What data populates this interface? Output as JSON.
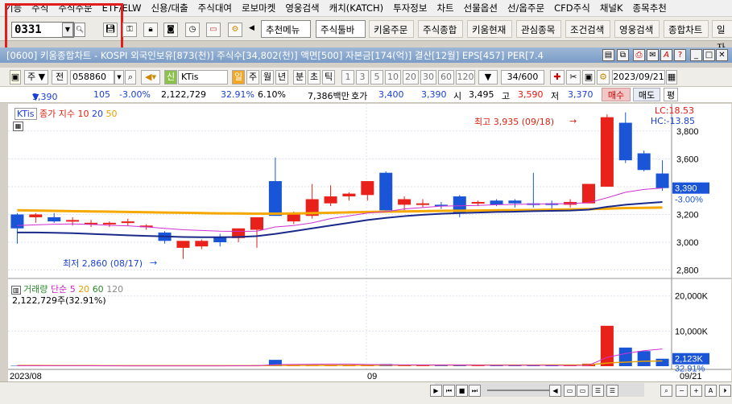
{
  "menu": [
    "기능",
    "주식",
    "주식주문",
    "ETF/ELW",
    "신용/대출",
    "주식대여",
    "로보마켓",
    "영웅검색",
    "캐치(KATCH)",
    "투자정보",
    "차트",
    "선물옵션",
    "선/옵주문",
    "CFD주식",
    "채널K",
    "종목추천"
  ],
  "toolbar": {
    "code": "0331",
    "buttons": [
      "추천메뉴",
      "주식툴바",
      "키움주문",
      "주식종합",
      "키움현재",
      "관심종목",
      "조건검색",
      "영웅검색",
      "종합차트",
      "일자"
    ]
  },
  "window": {
    "title": "[0600] 키움종합차트 - KOSPI 외국인보유[873(천)] 주식수[34,802(천)] 액면[500] 자본금[174(억)] 결산[12월] EPS[457] PER[7.4"
  },
  "controls": {
    "type": "주",
    "prev": "전",
    "code": "058860",
    "name": "KTis",
    "periods": [
      "일",
      "주",
      "월",
      "년",
      "분",
      "초",
      "틱"
    ],
    "intervals": [
      "1",
      "3",
      "5",
      "10",
      "20",
      "30",
      "60",
      "120"
    ],
    "count": "34",
    "total": "/600",
    "date": "2023/09/21"
  },
  "quote": {
    "price": "3,390",
    "arrow": "▼",
    "change": "105",
    "rate": "-3.00%",
    "volume": "2,122,729",
    "vol_rate": "32.91%",
    "turnover": "6.10%",
    "amount": "7,386백만",
    "hoga_label": "호가",
    "ask": "3,400",
    "bid": "3,390",
    "open_label": "시",
    "open": "3,495",
    "high_label": "고",
    "high": "3,590",
    "low_label": "저",
    "low": "3,370",
    "buy": "매수",
    "sell": "매도",
    "eval": "평"
  },
  "price_panel": {
    "legend_name": "KTis",
    "legend_series": "종가 지수 10",
    "ma20": "20",
    "ma50": "50",
    "lc": "LC:18.53",
    "hc": "HC:-13.85",
    "high_note": "최고 3,935 (09/18)",
    "low_note": "최저 2,860 (08/17)",
    "y_ticks": [
      "3,800",
      "3,600",
      "3,400",
      "3,200",
      "3,000",
      "2,800"
    ],
    "current_price": "3,390",
    "current_rate": "-3.00%"
  },
  "volume_panel": {
    "legend": "거래량",
    "ma_label": "단순",
    "ma5": "5",
    "ma20": "20",
    "ma60": "60",
    "ma120": "120",
    "value": "2,122,729주(32.91%)",
    "y_ticks": [
      "20,000K",
      "10,000K"
    ],
    "current": "2,123K",
    "current_rate": "32.91%"
  },
  "x_axis": {
    "start": "2023/08",
    "mid": "09",
    "end": "09/21"
  },
  "chart_data": {
    "type": "candlestick",
    "ylim": [
      2780,
      3950
    ],
    "candles": [
      {
        "o": 3200,
        "h": 3210,
        "l": 2990,
        "c": 3100
      },
      {
        "o": 3180,
        "h": 3210,
        "l": 3140,
        "c": 3200
      },
      {
        "o": 3180,
        "h": 3210,
        "l": 3140,
        "c": 3150
      },
      {
        "o": 3150,
        "h": 3180,
        "l": 3120,
        "c": 3160
      },
      {
        "o": 3130,
        "h": 3160,
        "l": 3110,
        "c": 3140
      },
      {
        "o": 3130,
        "h": 3150,
        "l": 3110,
        "c": 3140
      },
      {
        "o": 3140,
        "h": 3170,
        "l": 3120,
        "c": 3150
      },
      {
        "o": 3110,
        "h": 3130,
        "l": 3090,
        "c": 3120
      },
      {
        "o": 3070,
        "h": 3080,
        "l": 2990,
        "c": 3010
      },
      {
        "o": 2960,
        "h": 3000,
        "l": 2880,
        "c": 3010
      },
      {
        "o": 2970,
        "h": 3020,
        "l": 2950,
        "c": 3010
      },
      {
        "o": 3040,
        "h": 3060,
        "l": 2970,
        "c": 3000
      },
      {
        "o": 3030,
        "h": 3080,
        "l": 3000,
        "c": 3100
      },
      {
        "o": 3090,
        "h": 3140,
        "l": 2960,
        "c": 3180
      },
      {
        "o": 3440,
        "h": 3610,
        "l": 3190,
        "c": 3190
      },
      {
        "o": 3150,
        "h": 3220,
        "l": 3130,
        "c": 3200
      },
      {
        "o": 3190,
        "h": 3420,
        "l": 3170,
        "c": 3310
      },
      {
        "o": 3280,
        "h": 3410,
        "l": 3260,
        "c": 3330
      },
      {
        "o": 3330,
        "h": 3360,
        "l": 3300,
        "c": 3350
      },
      {
        "o": 3340,
        "h": 3420,
        "l": 3300,
        "c": 3440
      },
      {
        "o": 3500,
        "h": 3510,
        "l": 3220,
        "c": 3230
      },
      {
        "o": 3270,
        "h": 3330,
        "l": 3230,
        "c": 3310
      },
      {
        "o": 3270,
        "h": 3310,
        "l": 3250,
        "c": 3280
      },
      {
        "o": 3270,
        "h": 3290,
        "l": 3240,
        "c": 3260
      },
      {
        "o": 3330,
        "h": 3340,
        "l": 3180,
        "c": 3210
      },
      {
        "o": 3280,
        "h": 3300,
        "l": 3260,
        "c": 3290
      },
      {
        "o": 3300,
        "h": 3310,
        "l": 3260,
        "c": 3270
      },
      {
        "o": 3300,
        "h": 3310,
        "l": 3250,
        "c": 3280
      },
      {
        "o": 3280,
        "h": 3500,
        "l": 3250,
        "c": 3270
      },
      {
        "o": 3280,
        "h": 3300,
        "l": 3240,
        "c": 3270
      },
      {
        "o": 3270,
        "h": 3310,
        "l": 3250,
        "c": 3290
      },
      {
        "o": 3280,
        "h": 3410,
        "l": 3280,
        "c": 3420
      },
      {
        "o": 3400,
        "h": 3920,
        "l": 3400,
        "c": 3900
      },
      {
        "o": 3860,
        "h": 3935,
        "l": 3570,
        "c": 3590
      },
      {
        "o": 3640,
        "h": 3660,
        "l": 3510,
        "c": 3520
      },
      {
        "o": 3495,
        "h": 3590,
        "l": 3370,
        "c": 3390
      }
    ],
    "ma10": [
      3120,
      3125,
      3130,
      3132,
      3128,
      3122,
      3118,
      3110,
      3100,
      3090,
      3085,
      3080,
      3078,
      3080,
      3110,
      3120,
      3140,
      3170,
      3190,
      3210,
      3220,
      3240,
      3250,
      3260,
      3262,
      3265,
      3270,
      3272,
      3275,
      3277,
      3278,
      3285,
      3320,
      3360,
      3380,
      3390
    ],
    "ma20": [
      3070,
      3070,
      3068,
      3065,
      3060,
      3055,
      3050,
      3046,
      3042,
      3038,
      3036,
      3036,
      3038,
      3044,
      3060,
      3080,
      3100,
      3120,
      3140,
      3160,
      3175,
      3188,
      3198,
      3205,
      3210,
      3214,
      3218,
      3220,
      3224,
      3226,
      3228,
      3235,
      3255,
      3270,
      3280,
      3290
    ],
    "ma50": [
      3230,
      3228,
      3226,
      3224,
      3222,
      3220,
      3218,
      3216,
      3214,
      3212,
      3210,
      3208,
      3207,
      3206,
      3206,
      3207,
      3209,
      3212,
      3215,
      3218,
      3220,
      3222,
      3224,
      3226,
      3227,
      3228,
      3230,
      3231,
      3232,
      3234,
      3236,
      3238,
      3242,
      3246,
      3248,
      3250
    ],
    "volume": [
      120,
      110,
      110,
      100,
      100,
      100,
      100,
      100,
      100,
      110,
      100,
      110,
      130,
      300,
      1800,
      300,
      350,
      300,
      250,
      280,
      600,
      250,
      220,
      200,
      300,
      180,
      170,
      180,
      250,
      200,
      200,
      700,
      11500,
      5300,
      4300,
      2123
    ],
    "volume_ylim": [
      0,
      22000
    ],
    "volume_ma5": [
      150,
      150,
      140,
      130,
      120,
      110,
      100,
      100,
      100,
      100,
      100,
      100,
      110,
      140,
      430,
      520,
      560,
      600,
      600,
      500,
      420,
      380,
      350,
      330,
      330,
      290,
      260,
      250,
      250,
      220,
      200,
      240,
      2500,
      3600,
      4400,
      4900
    ],
    "volume_ma20": [
      200,
      190,
      180,
      170,
      160,
      150,
      150,
      140,
      140,
      140,
      130,
      130,
      130,
      140,
      220,
      230,
      240,
      250,
      260,
      270,
      290,
      300,
      310,
      310,
      320,
      320,
      320,
      320,
      320,
      330,
      340,
      370,
      900,
      1150,
      1400,
      1500
    ]
  }
}
